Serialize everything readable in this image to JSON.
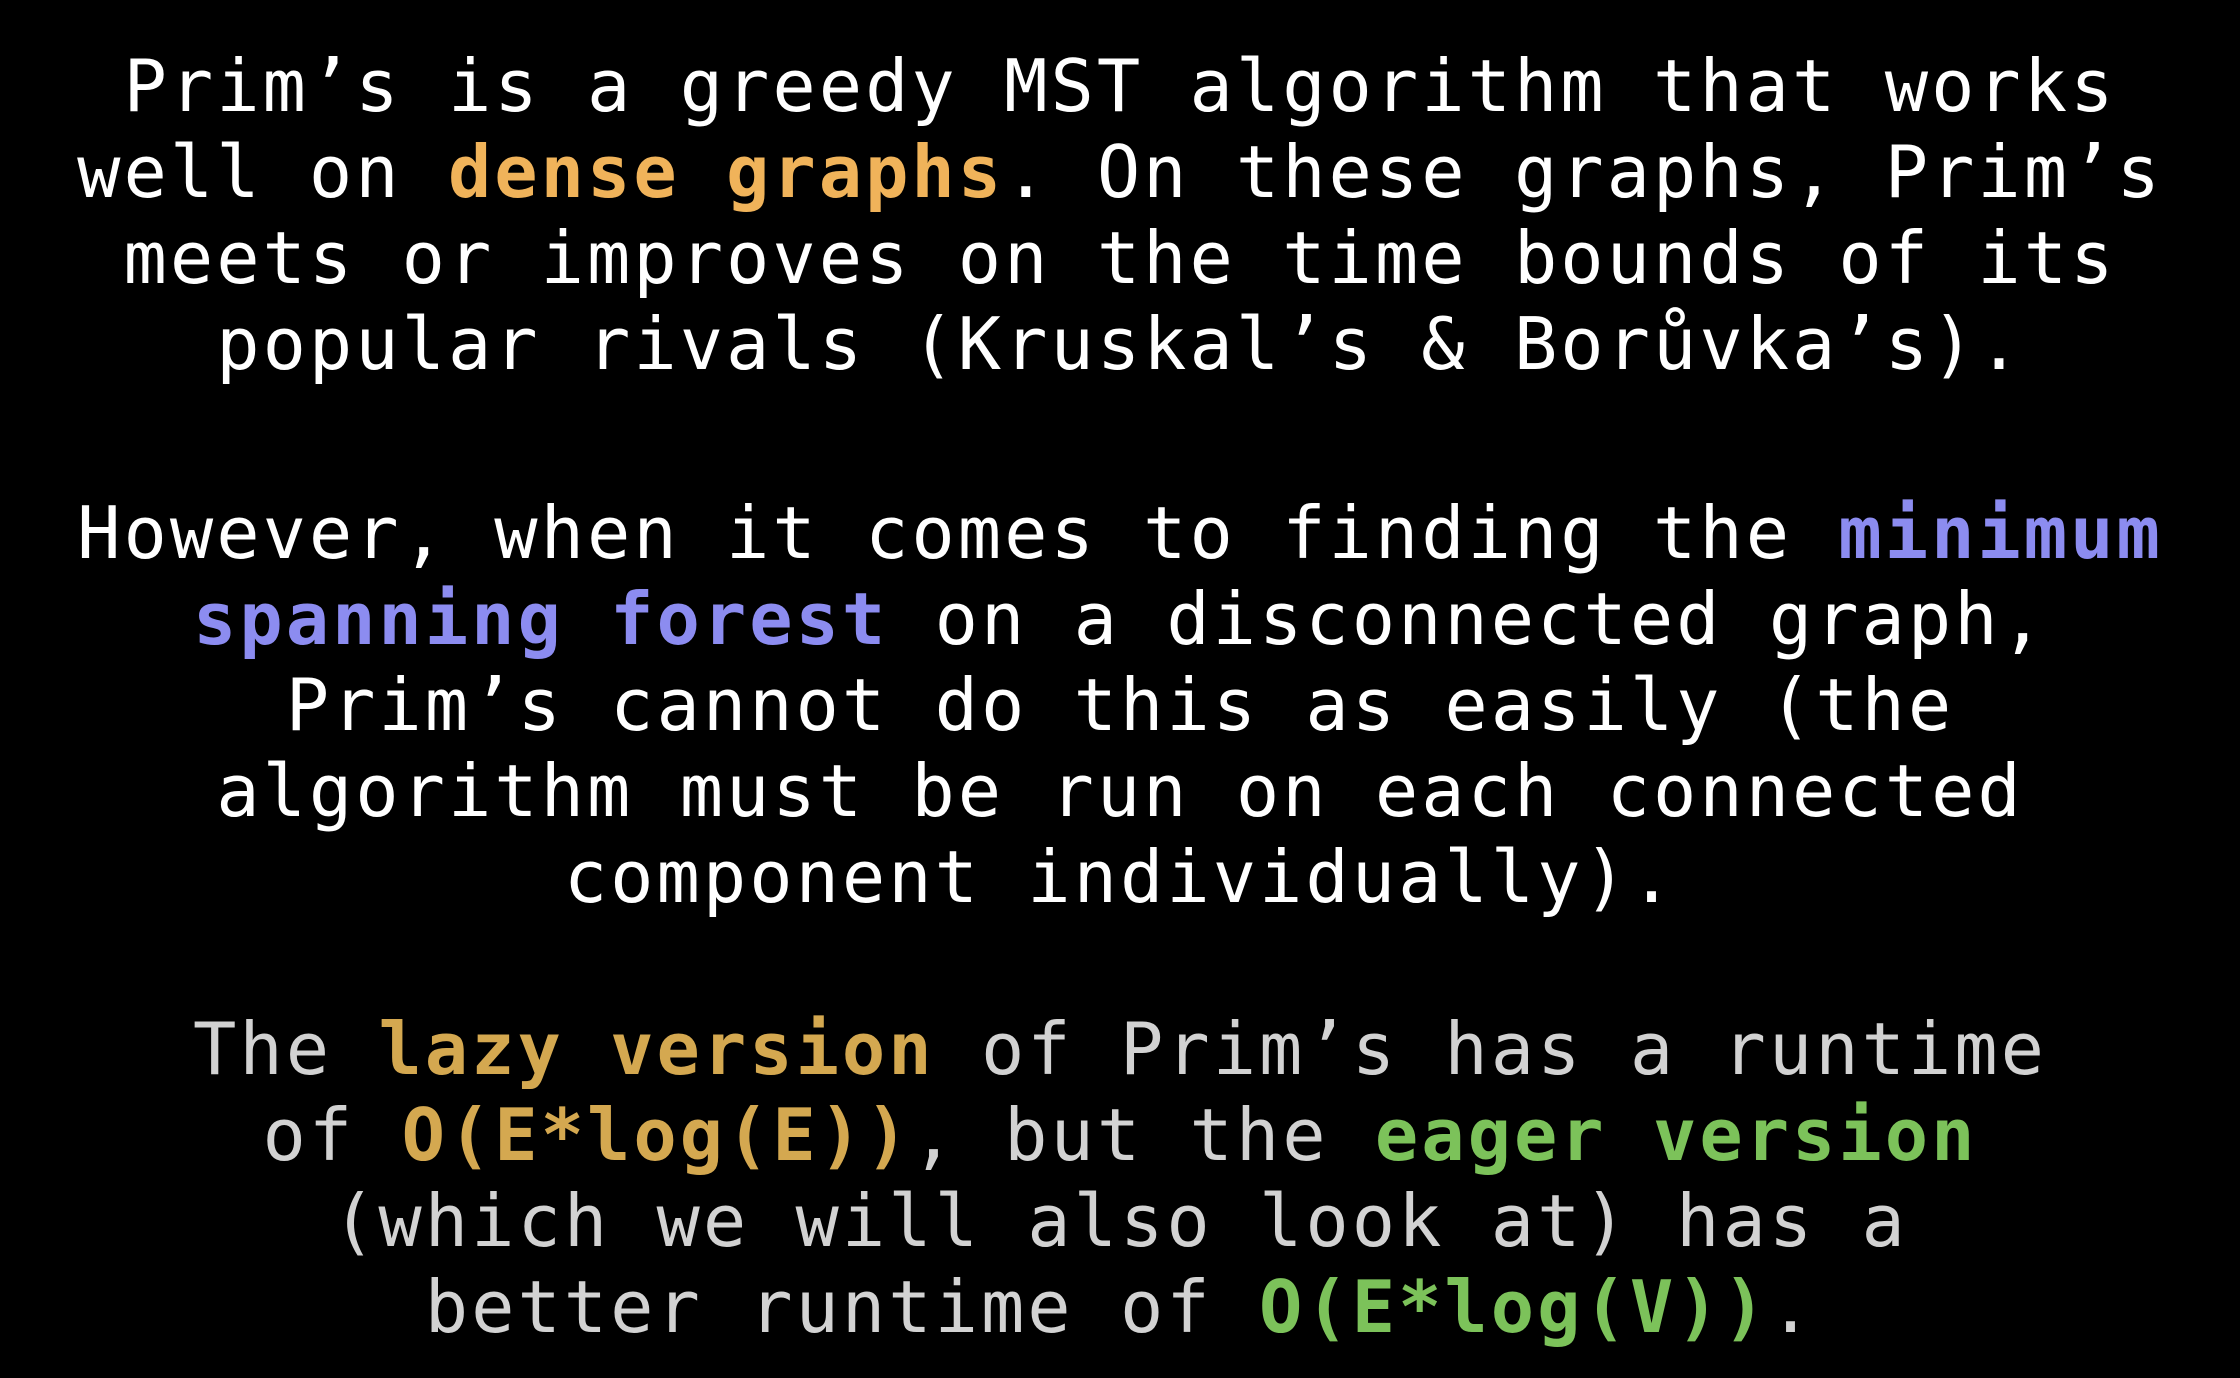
{
  "colors": {
    "background": "#000000",
    "text": "#ffffff",
    "text_dim": "#d2d2d2",
    "orange": "#f0b35a",
    "purple": "#8c8cf0",
    "gold": "#d4a850",
    "green": "#7cc25a"
  },
  "paragraph1": {
    "l1": "Prim’s is a greedy MST algorithm that works",
    "l2_a": "well on ",
    "l2_hl": "dense graphs",
    "l2_b": ". On these graphs, Prim’s",
    "l3": "meets or improves on the time bounds of its",
    "l4": "popular rivals (Kruskal’s & Borůvka’s)."
  },
  "paragraph2": {
    "l1_a": "However, when it comes to finding the ",
    "l1_hl": "minimum",
    "l2_hl": "spanning forest",
    "l2_b": " on a disconnected graph,",
    "l3": "Prim’s cannot do this as easily (the",
    "l4": "algorithm must be run on each connected",
    "l5": "component individually)."
  },
  "paragraph3": {
    "l1_a": "The ",
    "l1_hl": "lazy version",
    "l1_b": " of Prim’s has a runtime",
    "l2_a": "of ",
    "l2_hl1": "O(E*log(E))",
    "l2_b": ", but the ",
    "l2_hl2": "eager version",
    "l3": "(which we will also look at) has a",
    "l4_a": "better runtime of ",
    "l4_hl": "O(E*log(V))",
    "l4_b": "."
  }
}
